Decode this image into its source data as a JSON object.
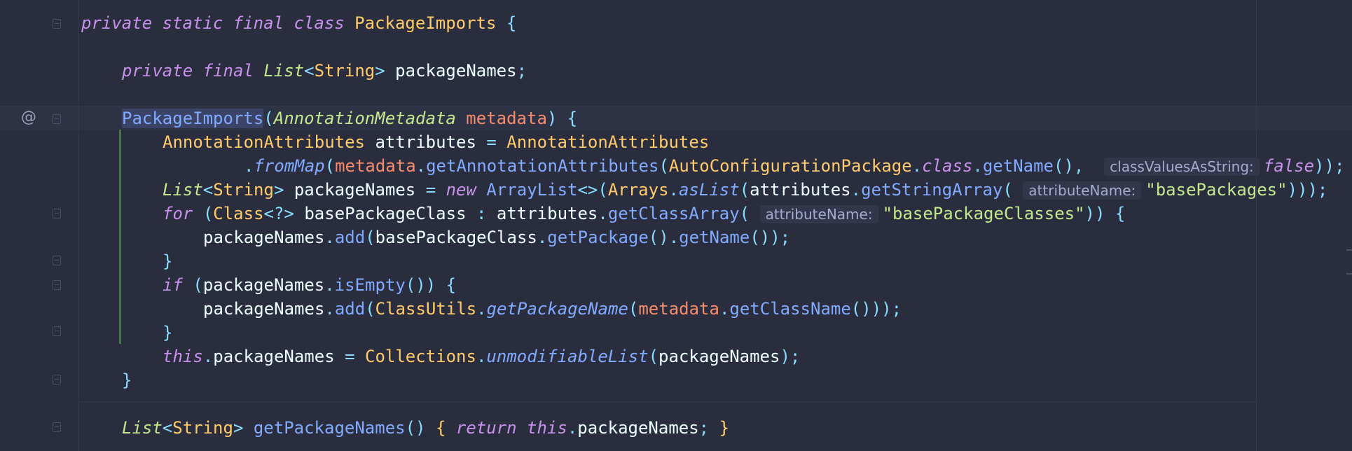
{
  "editor": {
    "gutter_marker": "@",
    "line1": {
      "kw1": "private",
      "kw2": "static",
      "kw3": "final",
      "kw4": "class",
      "class_name": "PackageImports",
      "brace": "{"
    },
    "line2": {
      "kw1": "private",
      "kw2": "final",
      "type1": "List",
      "lt": "<",
      "type2": "String",
      "gt": ">",
      "field": "packageNames",
      "semi": ";"
    },
    "line3": {
      "ctor": "PackageImports",
      "open": "(",
      "ptype": "AnnotationMetadata",
      "pname": "metadata",
      "close": ")",
      "brace": "{"
    },
    "line4": {
      "type": "AnnotationAttributes",
      "var": "attributes",
      "eq": "=",
      "type2": "AnnotationAttributes"
    },
    "line5": {
      "dot": ".",
      "fn": "fromMap",
      "open": "(",
      "param": "metadata",
      "dot2": ".",
      "fn2": "getAnnotationAttributes",
      "open2": "(",
      "cls": "AutoConfigurationPackage",
      "dot3": ".",
      "kw": "class",
      "dot4": ".",
      "fn3": "getName",
      "call": "(),",
      "hint": "classValuesAsString:",
      "val": "false",
      "end": "));"
    },
    "line6": {
      "type1": "List",
      "lt": "<",
      "type2": "String",
      "gt": ">",
      "var": "packageNames",
      "eq": "=",
      "kw": "new",
      "cls": "ArrayList",
      "diamond": "<>(",
      "cls2": "Arrays",
      "dot": ".",
      "fn": "asList",
      "open": "(",
      "obj": "attributes",
      "dot2": ".",
      "fn2": "getStringArray",
      "open2": "(",
      "hint": "attributeName:",
      "str": "\"basePackages\"",
      "end": ")));"
    },
    "line7": {
      "kw": "for",
      "open": "(",
      "type": "Class",
      "generic": "<?>",
      "var": "basePackageClass",
      "colon": ":",
      "obj": "attributes",
      "dot": ".",
      "fn": "getClassArray",
      "open2": "(",
      "hint": "attributeName:",
      "str": "\"basePackageClasses\"",
      "end": "))",
      "brace": "{"
    },
    "line8": {
      "obj": "packageNames",
      "dot": ".",
      "fn": "add",
      "open": "(",
      "obj2": "basePackageClass",
      "dot2": ".",
      "fn2": "getPackage",
      "call": "().",
      "fn3": "getName",
      "end": "());"
    },
    "line9": {
      "brace": "}"
    },
    "line10": {
      "kw": "if",
      "open": "(",
      "obj": "packageNames",
      "dot": ".",
      "fn": "isEmpty",
      "end": "())",
      "brace": "{"
    },
    "line11": {
      "obj": "packageNames",
      "dot": ".",
      "fn": "add",
      "open": "(",
      "cls": "ClassUtils",
      "dot2": ".",
      "fn2": "getPackageName",
      "open2": "(",
      "param": "metadata",
      "dot3": ".",
      "fn3": "getClassName",
      "end": "()));"
    },
    "line12": {
      "brace": "}"
    },
    "line13": {
      "kw": "this",
      "dot": ".",
      "field": "packageNames",
      "eq": "=",
      "cls": "Collections",
      "dot2": ".",
      "fn": "unmodifiableList",
      "open": "(",
      "var": "packageNames",
      "end": ");"
    },
    "line14": {
      "brace": "}"
    },
    "line15": {
      "type1": "List",
      "lt": "<",
      "type2": "String",
      "gt": ">",
      "fn": "getPackageNames",
      "call": "()",
      "brace": "{",
      "kw1": "return",
      "kw2": "this",
      "dot": ".",
      "field": "packageNames",
      "semi": ";",
      "brace2": "}"
    }
  }
}
